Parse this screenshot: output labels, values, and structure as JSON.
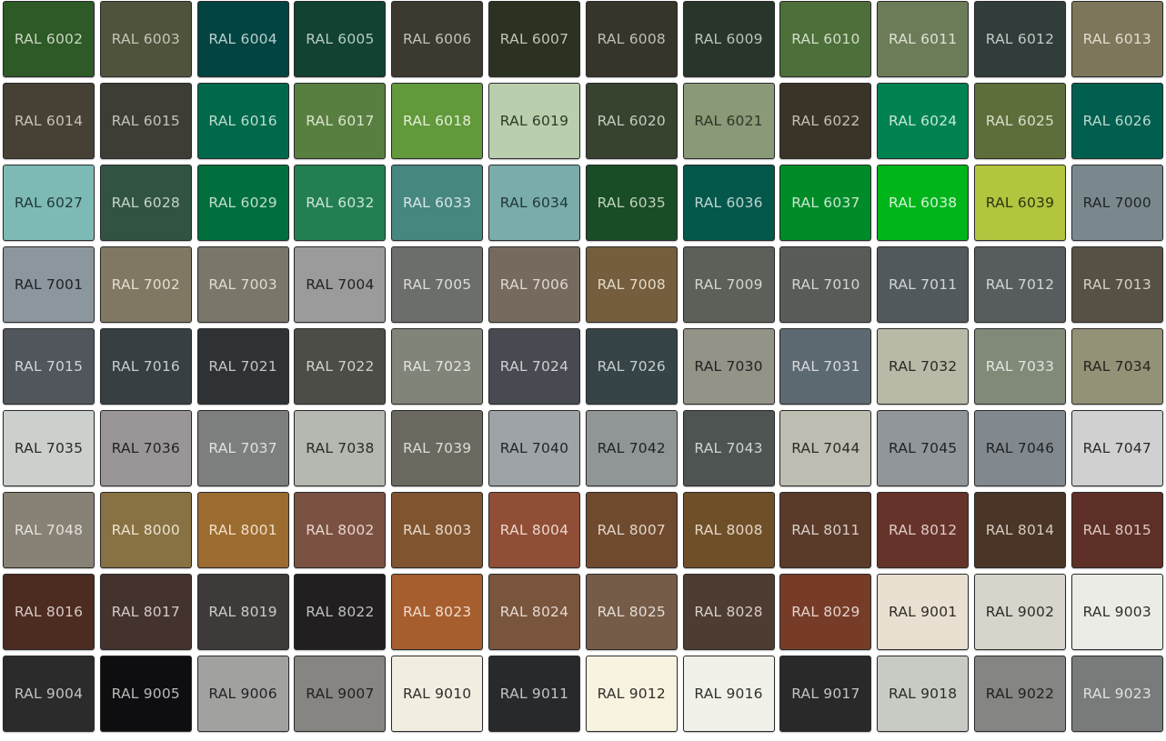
{
  "swatches": [
    {
      "label": "RAL 6002",
      "color": "#2d5a27",
      "text": "#c9d6c2"
    },
    {
      "label": "RAL 6003",
      "color": "#50533c",
      "text": "#c4c5b8"
    },
    {
      "label": "RAL 6004",
      "color": "#024442",
      "text": "#b9d0cd"
    },
    {
      "label": "RAL 6005",
      "color": "#114232",
      "text": "#b6cbc1"
    },
    {
      "label": "RAL 6006",
      "color": "#3c392e",
      "text": "#c3c1b8"
    },
    {
      "label": "RAL 6007",
      "color": "#2c3222",
      "text": "#c1c4b7"
    },
    {
      "label": "RAL 6008",
      "color": "#37342a",
      "text": "#c1bfb5"
    },
    {
      "label": "RAL 6009",
      "color": "#27352a",
      "text": "#bcc3bb"
    },
    {
      "label": "RAL 6010",
      "color": "#4d6f39",
      "text": "#d3dcc8"
    },
    {
      "label": "RAL 6011",
      "color": "#6c7c59",
      "text": "#dde2d3"
    },
    {
      "label": "RAL 6012",
      "color": "#303d3a",
      "text": "#c2c9c6"
    },
    {
      "label": "RAL 6013",
      "color": "#7d765a",
      "text": "#e2ddcd"
    },
    {
      "label": "RAL 6014",
      "color": "#474135",
      "text": "#c6c2b8"
    },
    {
      "label": "RAL 6015",
      "color": "#3d3d36",
      "text": "#c3c3bd"
    },
    {
      "label": "RAL 6016",
      "color": "#00694c",
      "text": "#bfdccf"
    },
    {
      "label": "RAL 6017",
      "color": "#587f40",
      "text": "#dbe5cf"
    },
    {
      "label": "RAL 6018",
      "color": "#61993b",
      "text": "#e3efd6"
    },
    {
      "label": "RAL 6019",
      "color": "#b9ceac",
      "text": "#2e3a2a"
    },
    {
      "label": "RAL 6020",
      "color": "#37422f",
      "text": "#c6cdbf"
    },
    {
      "label": "RAL 6021",
      "color": "#8a9977",
      "text": "#2e3526"
    },
    {
      "label": "RAL 6022",
      "color": "#3a3327",
      "text": "#c4bfb5"
    },
    {
      "label": "RAL 6024",
      "color": "#008351",
      "text": "#c6e8d6"
    },
    {
      "label": "RAL 6025",
      "color": "#5e6e3b",
      "text": "#d8dec8"
    },
    {
      "label": "RAL 6026",
      "color": "#005f4e",
      "text": "#bcd8d0"
    },
    {
      "label": "RAL 6027",
      "color": "#7ebab5",
      "text": "#1d3a38"
    },
    {
      "label": "RAL 6028",
      "color": "#315442",
      "text": "#c5d3cb"
    },
    {
      "label": "RAL 6029",
      "color": "#006f3d",
      "text": "#c1dfcd"
    },
    {
      "label": "RAL 6032",
      "color": "#237f52",
      "text": "#cce5d7"
    },
    {
      "label": "RAL 6033",
      "color": "#46877f",
      "text": "#d6e7e4"
    },
    {
      "label": "RAL 6034",
      "color": "#7aacac",
      "text": "#1f3737"
    },
    {
      "label": "RAL 6035",
      "color": "#194d25",
      "text": "#bfd1c2"
    },
    {
      "label": "RAL 6036",
      "color": "#04574b",
      "text": "#bcd5cf"
    },
    {
      "label": "RAL 6037",
      "color": "#008b29",
      "text": "#c7e9cf"
    },
    {
      "label": "RAL 6038",
      "color": "#00b51a",
      "text": "#d4f3d6"
    },
    {
      "label": "RAL 6039",
      "color": "#b3c43e",
      "text": "#2f3510"
    },
    {
      "label": "RAL 7000",
      "color": "#7a888e",
      "text": "#1e2426"
    },
    {
      "label": "RAL 7001",
      "color": "#8c969d",
      "text": "#1f2326"
    },
    {
      "label": "RAL 7002",
      "color": "#817863",
      "text": "#e3ddd1"
    },
    {
      "label": "RAL 7003",
      "color": "#7a7669",
      "text": "#dfdcd4"
    },
    {
      "label": "RAL 7004",
      "color": "#9b9b9b",
      "text": "#222222"
    },
    {
      "label": "RAL 7005",
      "color": "#6c6e6b",
      "text": "#dcdddb"
    },
    {
      "label": "RAL 7006",
      "color": "#766a5e",
      "text": "#ded8d2"
    },
    {
      "label": "RAL 7008",
      "color": "#745e3d",
      "text": "#e3d9ca"
    },
    {
      "label": "RAL 7009",
      "color": "#5d6058",
      "text": "#d5d7d2"
    },
    {
      "label": "RAL 7010",
      "color": "#585c56",
      "text": "#d3d5d2"
    },
    {
      "label": "RAL 7011",
      "color": "#52595d",
      "text": "#d1d4d6"
    },
    {
      "label": "RAL 7012",
      "color": "#575d5e",
      "text": "#d2d5d6"
    },
    {
      "label": "RAL 7013",
      "color": "#575044",
      "text": "#d4cfc7"
    },
    {
      "label": "RAL 7015",
      "color": "#51565c",
      "text": "#d0d3d7"
    },
    {
      "label": "RAL 7016",
      "color": "#373f43",
      "text": "#c6cbce"
    },
    {
      "label": "RAL 7021",
      "color": "#2e3234",
      "text": "#c3c5c6"
    },
    {
      "label": "RAL 7022",
      "color": "#4b4d46",
      "text": "#cfd0cb"
    },
    {
      "label": "RAL 7023",
      "color": "#818479",
      "text": "#e2e3de"
    },
    {
      "label": "RAL 7024",
      "color": "#474a50",
      "text": "#cdcfd2"
    },
    {
      "label": "RAL 7026",
      "color": "#374447",
      "text": "#c6cdce"
    },
    {
      "label": "RAL 7030",
      "color": "#939388",
      "text": "#222220"
    },
    {
      "label": "RAL 7031",
      "color": "#5d6970",
      "text": "#d5dadd"
    },
    {
      "label": "RAL 7032",
      "color": "#b9b9a8",
      "text": "#2b2b25"
    },
    {
      "label": "RAL 7033",
      "color": "#818979",
      "text": "#e2e5de"
    },
    {
      "label": "RAL 7034",
      "color": "#939176",
      "text": "#25241c"
    },
    {
      "label": "RAL 7035",
      "color": "#cbd0cc",
      "text": "#2a2c2b"
    },
    {
      "label": "RAL 7036",
      "color": "#9a9697",
      "text": "#232223"
    },
    {
      "label": "RAL 7037",
      "color": "#7c7f7e",
      "text": "#e0e1e1"
    },
    {
      "label": "RAL 7038",
      "color": "#b4b8b0",
      "text": "#292b28"
    },
    {
      "label": "RAL 7039",
      "color": "#6b695f",
      "text": "#dcdbd6"
    },
    {
      "label": "RAL 7040",
      "color": "#9da3a6",
      "text": "#232628"
    },
    {
      "label": "RAL 7042",
      "color": "#8f9695",
      "text": "#212424"
    },
    {
      "label": "RAL 7043",
      "color": "#4e5451",
      "text": "#d0d3d1"
    },
    {
      "label": "RAL 7044",
      "color": "#bdbdb2",
      "text": "#2b2b27"
    },
    {
      "label": "RAL 7045",
      "color": "#91969a",
      "text": "#212426"
    },
    {
      "label": "RAL 7046",
      "color": "#82898e",
      "text": "#1f2224"
    },
    {
      "label": "RAL 7047",
      "color": "#cfd0cf",
      "text": "#2a2b2a"
    },
    {
      "label": "RAL 7048",
      "color": "#888175",
      "text": "#e5e2dc"
    },
    {
      "label": "RAL 8000",
      "color": "#887142",
      "text": "#ece3d0"
    },
    {
      "label": "RAL 8001",
      "color": "#9c6b30",
      "text": "#f1dfc8"
    },
    {
      "label": "RAL 8002",
      "color": "#7b5141",
      "text": "#e6d6cf"
    },
    {
      "label": "RAL 8003",
      "color": "#80542f",
      "text": "#e9d9cb"
    },
    {
      "label": "RAL 8004",
      "color": "#8f4e35",
      "text": "#eed6cc"
    },
    {
      "label": "RAL 8007",
      "color": "#6f4a2f",
      "text": "#e3d4c8"
    },
    {
      "label": "RAL 8008",
      "color": "#6f4f28",
      "text": "#e3d6c5"
    },
    {
      "label": "RAL 8011",
      "color": "#5a3a29",
      "text": "#dacec7"
    },
    {
      "label": "RAL 8012",
      "color": "#66332b",
      "text": "#dfcbc7"
    },
    {
      "label": "RAL 8014",
      "color": "#4a3526",
      "text": "#d4cbc3"
    },
    {
      "label": "RAL 8015",
      "color": "#5e2f26",
      "text": "#dbc9c4"
    },
    {
      "label": "RAL 8016",
      "color": "#4c2b20",
      "text": "#d6c8c3"
    },
    {
      "label": "RAL 8017",
      "color": "#44322d",
      "text": "#d2c9c6"
    },
    {
      "label": "RAL 8019",
      "color": "#3f3a3a",
      "text": "#cdcaca"
    },
    {
      "label": "RAL 8022",
      "color": "#211f20",
      "text": "#c0bfbf"
    },
    {
      "label": "RAL 8023",
      "color": "#a65e2e",
      "text": "#f3dccb"
    },
    {
      "label": "RAL 8024",
      "color": "#79553d",
      "text": "#e5d8ce"
    },
    {
      "label": "RAL 8025",
      "color": "#755c48",
      "text": "#e4dbd3"
    },
    {
      "label": "RAL 8028",
      "color": "#4e3b31",
      "text": "#d6cdc8"
    },
    {
      "label": "RAL 8029",
      "color": "#763c28",
      "text": "#e5d2ca"
    },
    {
      "label": "RAL 9001",
      "color": "#e9e0d2",
      "text": "#2f2c27"
    },
    {
      "label": "RAL 9002",
      "color": "#d7d5cb",
      "text": "#2c2b27"
    },
    {
      "label": "RAL 9003",
      "color": "#ecece7",
      "text": "#2f2f2d"
    },
    {
      "label": "RAL 9004",
      "color": "#2b2b2c",
      "text": "#c3c3c3"
    },
    {
      "label": "RAL 9005",
      "color": "#0e0e10",
      "text": "#b9b9ba"
    },
    {
      "label": "RAL 9006",
      "color": "#a1a1a0",
      "text": "#232323"
    },
    {
      "label": "RAL 9007",
      "color": "#878581",
      "text": "#222120"
    },
    {
      "label": "RAL 9010",
      "color": "#f1ede1",
      "text": "#302e29"
    },
    {
      "label": "RAL 9011",
      "color": "#27292b",
      "text": "#c2c3c4"
    },
    {
      "label": "RAL 9012",
      "color": "#f8f2e1",
      "text": "#312f29"
    },
    {
      "label": "RAL 9016",
      "color": "#f1f1ea",
      "text": "#30302d"
    },
    {
      "label": "RAL 9017",
      "color": "#29292a",
      "text": "#c3c3c3"
    },
    {
      "label": "RAL 9018",
      "color": "#c8cbc4",
      "text": "#2a2b29"
    },
    {
      "label": "RAL 9022",
      "color": "#858583",
      "text": "#212121"
    },
    {
      "label": "RAL 9023",
      "color": "#797b7a",
      "text": "#dfe0df"
    }
  ]
}
